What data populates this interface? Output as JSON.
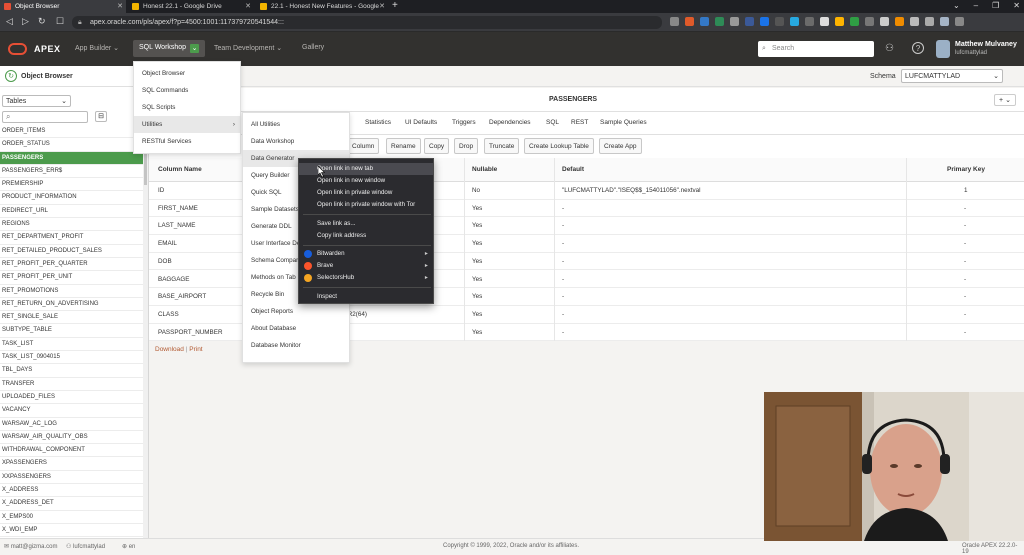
{
  "browser": {
    "tabs": [
      {
        "label": "Object Browser",
        "active": true
      },
      {
        "label": "Honest 22.1 - Google Drive",
        "active": false
      },
      {
        "label": "22.1 - Honest New Features - Google",
        "active": false
      }
    ],
    "url": "apex.oracle.com/pls/apex/f?p=4500:1001:117379720541544:::"
  },
  "header": {
    "app_name": "APEX",
    "nav": {
      "app_builder": "App Builder",
      "sql_workshop": "SQL Workshop",
      "team_development": "Team Development",
      "gallery": "Gallery"
    },
    "search_placeholder": "Search",
    "user_name": "Matthew Mulvaney",
    "user_id": "lufcmattylad"
  },
  "sql_workshop_menu": [
    "Object Browser",
    "SQL Commands",
    "SQL Scripts",
    "Utilities",
    "RESTful Services"
  ],
  "utilities_menu": [
    "All Utilities",
    "Data Workshop",
    "Data Generator",
    "Query Builder",
    "Quick SQL",
    "Sample Datasets",
    "Generate DDL",
    "User Interface Defaults",
    "Schema Comparison",
    "Methods on Tables",
    "Recycle Bin",
    "Object Reports",
    "About Database",
    "Database Monitor"
  ],
  "utilities_menu_visible": [
    "All Utilities",
    "Data Workshop",
    "Data Generator",
    "Query Builder",
    "Quick SQL",
    "Sample Datasets",
    "Generate DDL",
    "User Interface De",
    "Schema Compar",
    "Methods on Tab",
    "Recycle Bin",
    "Object Reports",
    "About Database",
    "Database Monitor"
  ],
  "context_menu": {
    "items": [
      "Open link in new tab",
      "Open link in new window",
      "Open link in private window",
      "Open link in private window with Tor",
      "Save link as...",
      "Copy link address",
      "Bitwarden",
      "Brave",
      "SelectorsHub",
      "Inspect"
    ]
  },
  "left_panel": {
    "title": "Object Browser",
    "type_select": "Tables",
    "objects": [
      "ORDER_ITEMS",
      "ORDER_STATUS",
      "PASSENGERS",
      "PASSENGERS_ERR$",
      "PREMIERSHIP",
      "PRODUCT_INFORMATION",
      "REDIRECT_URL",
      "REGIONS",
      "RET_DEPARTMENT_PROFIT",
      "RET_DETAILED_PRODUCT_SALES",
      "RET_PROFIT_PER_QUARTER",
      "RET_PROFIT_PER_UNIT",
      "RET_PROMOTIONS",
      "RET_RETURN_ON_ADVERTISING",
      "RET_SINGLE_SALE",
      "SUBTYPE_TABLE",
      "TASK_LIST",
      "TASK_LIST_0904015",
      "TBL_DAYS",
      "TRANSFER",
      "UPLOADED_FILES",
      "VACANCY",
      "WARSAW_AC_LOG",
      "WARSAW_AIR_QUALITY_OBS",
      "WITHDRAWAL_COMPONENT",
      "XPASSENGERS",
      "XXPASSENGERS",
      "X_ADDRESS",
      "X_ADDRESS_DET",
      "X_EMPS00",
      "X_WDI_EMP"
    ],
    "selected": "PASSENGERS"
  },
  "main": {
    "schema_label": "Schema",
    "schema_value": "LUFCMATTYLAD",
    "object_name": "PASSENGERS",
    "tabs": [
      "Statistics",
      "UI Defaults",
      "Triggers",
      "Dependencies",
      "SQL",
      "REST",
      "Sample Queries"
    ],
    "buttons": [
      "Column",
      "Rename",
      "Copy",
      "Drop",
      "Truncate",
      "Create Lookup Table",
      "Create App"
    ],
    "columns_header": {
      "name": "Column Name",
      "nullable": "Nullable",
      "default": "Default",
      "pk": "Primary Key"
    },
    "rows": [
      {
        "name": "ID",
        "type": "",
        "nullable": "No",
        "default": "\"LUFCMATTYLAD\".\"ISEQ$$_154011056\".nextval",
        "pk": "1"
      },
      {
        "name": "FIRST_NAME",
        "type": "",
        "nullable": "Yes",
        "default": "-",
        "pk": "-"
      },
      {
        "name": "LAST_NAME",
        "type": "",
        "nullable": "Yes",
        "default": "-",
        "pk": "-"
      },
      {
        "name": "EMAIL",
        "type": "",
        "nullable": "Yes",
        "default": "-",
        "pk": "-"
      },
      {
        "name": "DOB",
        "type": "",
        "nullable": "Yes",
        "default": "-",
        "pk": "-"
      },
      {
        "name": "BAGGAGE",
        "type": "",
        "nullable": "Yes",
        "default": "-",
        "pk": "-"
      },
      {
        "name": "BASE_AIRPORT",
        "type": "",
        "nullable": "Yes",
        "default": "-",
        "pk": "-"
      },
      {
        "name": "CLASS",
        "type": "HAR2(64)",
        "nullable": "Yes",
        "default": "-",
        "pk": "-"
      },
      {
        "name": "PASSPORT_NUMBER",
        "type": "ER",
        "nullable": "Yes",
        "default": "-",
        "pk": "-"
      }
    ],
    "download": "Download",
    "print": "Print",
    "separator": "|"
  },
  "footer": {
    "email": "matt@gizma.com",
    "user": "lufcmattylad",
    "lang": "en",
    "copyright": "Copyright © 1999, 2022, Oracle and/or its affiliates.",
    "version": "Oracle APEX 22.2.0-19"
  },
  "colors": {
    "accent": "#4c9b4c",
    "apex_red": "#e64f35",
    "header_bg": "#32312f"
  }
}
